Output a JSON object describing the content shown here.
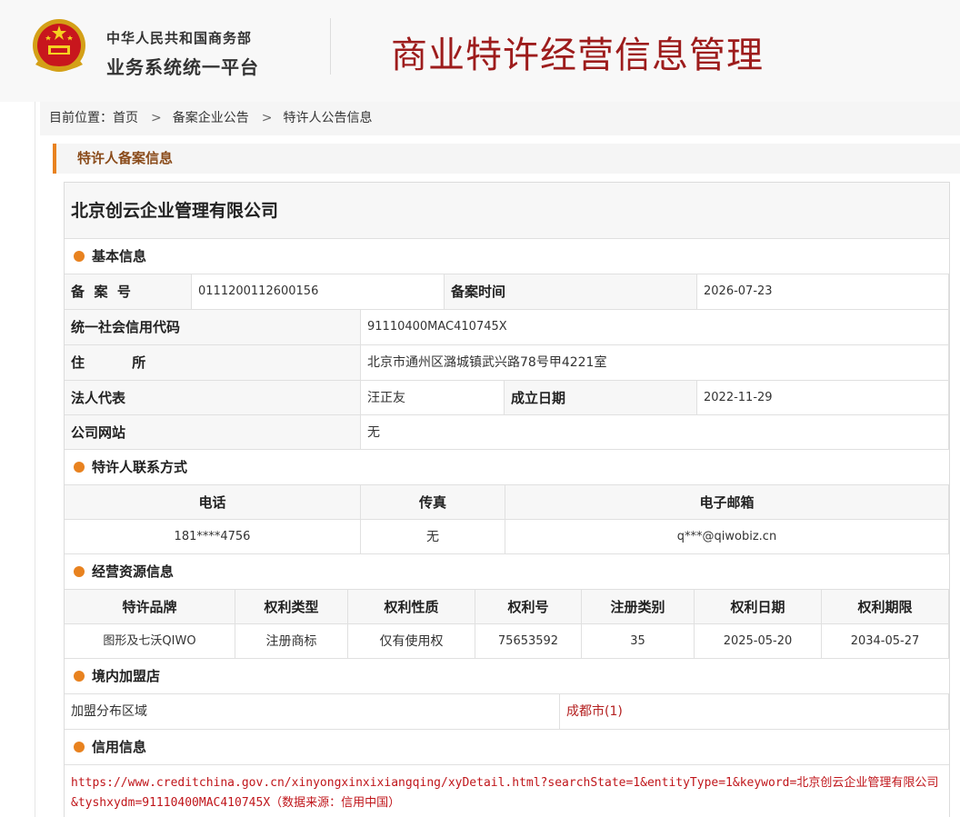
{
  "header": {
    "org_line1": "中华人民共和国商务部",
    "org_line2": "业务系统统一平台",
    "title": "商业特许经营信息管理"
  },
  "breadcrumb": {
    "prefix": "目前位置：",
    "items": [
      "首页",
      "备案企业公告",
      "特许人公告信息"
    ],
    "separator": ">"
  },
  "section_title": "特许人备案信息",
  "company_name": "北京创云企业管理有限公司",
  "basic_info": {
    "heading": "基本信息",
    "record_no_label": "备  案  号",
    "record_no": "011120011260015​6",
    "record_time_label": "备案时间",
    "record_time": "2026-07-23",
    "credit_code_label": "统一社会信用代码",
    "credit_code": "91110400MAC410745X",
    "address_label": "住          所",
    "address": "北京市通州区潞城镇武兴路78号甲4221室",
    "legal_rep_label": "法人代表",
    "legal_rep": "汪正友",
    "founded_label": "成立日期",
    "founded": "2022-11-29",
    "website_label": "公司网站",
    "website": "无"
  },
  "contact": {
    "heading": "特许人联系方式",
    "headers": [
      "电话",
      "传真",
      "电子邮箱"
    ],
    "phone": "181****4756",
    "fax": "无",
    "email": "q***@qiwobiz.cn"
  },
  "resources": {
    "heading": "经营资源信息",
    "headers": [
      "特许品牌",
      "权利类型",
      "权利性质",
      "权利号",
      "注册类别",
      "权利日期",
      "权利期限"
    ],
    "row": [
      "图形及七沃QIWO",
      "注册商标",
      "仅有使用权",
      "75653592",
      "35",
      "2025-05-20",
      "2034-05-27"
    ]
  },
  "franchise": {
    "heading": "境内加盟店",
    "label": "加盟分布区域",
    "value": "成都市(1)"
  },
  "credit": {
    "heading": "信用信息",
    "line1": "https://www.creditchina.gov.cn/xinyongxinxixiangqing/xyDetail.html?searchState=1&entityType=1&keyword=北京创云企业管理有限公司",
    "line2": "&tyshxydm=91110400MAC410745X（数据来源：信用中国）"
  },
  "colors": {
    "accent": "#e8821f",
    "title_red": "#9d1c1c",
    "link_red": "#c0161b"
  }
}
